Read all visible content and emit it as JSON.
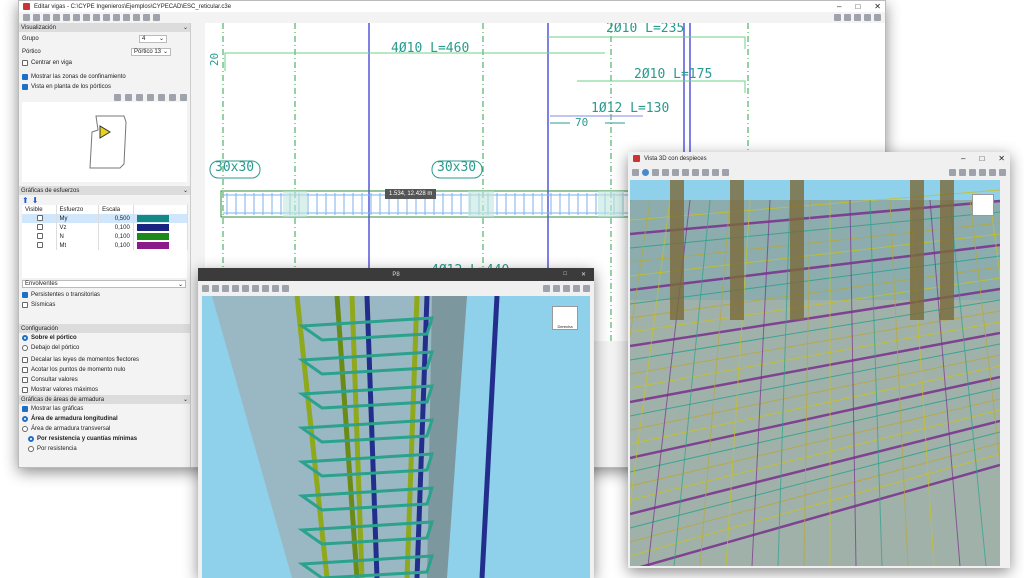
{
  "main": {
    "title": "Editar vigas - C:\\CYPE Ingenieros\\Ejemplos\\CYPECAD\\ESC_reticular.c3e",
    "visualizacion": {
      "header": "Visualización",
      "grupo_label": "Grupo",
      "grupo_value": "4",
      "portico_label": "Pórtico",
      "portico_value": "Pórtico 13",
      "centrar": "Centrar en viga",
      "mostrar_zonas": "Mostrar las zonas de confinamiento",
      "vista_planta": "Vista en planta de los pórticos"
    },
    "graficas": {
      "header": "Gráficas de esfuerzos",
      "columns": [
        "Visible",
        "Esfuerzo",
        "Escala"
      ],
      "rows": [
        {
          "name": "My",
          "scale": "0,500",
          "color": "#138a83"
        },
        {
          "name": "Vz",
          "scale": "0,100",
          "color": "#1a237e"
        },
        {
          "name": "N",
          "scale": "0,100",
          "color": "#1b8a1b"
        },
        {
          "name": "Mt",
          "scale": "0,100",
          "color": "#8a1a8a"
        }
      ],
      "combo": "Envolventes",
      "persistentes": "Persistentes o transitorias",
      "sismicas": "Sísmicas"
    },
    "configuracion": {
      "header": "Configuración",
      "sobre": "Sobre el pórtico",
      "debajo": "Debajo del pórtico",
      "decalar": "Decalar las leyes de momentos flectores",
      "acotar": "Acotar los puntos de momento nulo",
      "consultar": "Consultar valores",
      "maximos": "Mostrar valores máximos"
    },
    "areas": {
      "header": "Gráficas de áreas de armadura",
      "mostrar": "Mostrar las gráficas",
      "longitudinal": "Área de armadura longitudinal",
      "transversal": "Área de armadura transversal",
      "por_res_cuantias": "Por resistencia y cuantías mínimas",
      "por_res": "Por resistencia"
    },
    "drawing": {
      "bar1": "4Ø10 L=460",
      "bar2": "2Ø10 L=235",
      "bar3": "2Ø10 L=175",
      "bar4": "1Ø12 L=130",
      "bar5": "4Ø12 L=440",
      "dim70": "70",
      "hook": "20",
      "col1": "30x30",
      "col2": "30x30",
      "tooltip": "1.534, 12.428 m"
    }
  },
  "p8": {
    "title": "P8",
    "cube_label": "Derecha"
  },
  "vista3d": {
    "title": "Vista 3D con despieces"
  }
}
